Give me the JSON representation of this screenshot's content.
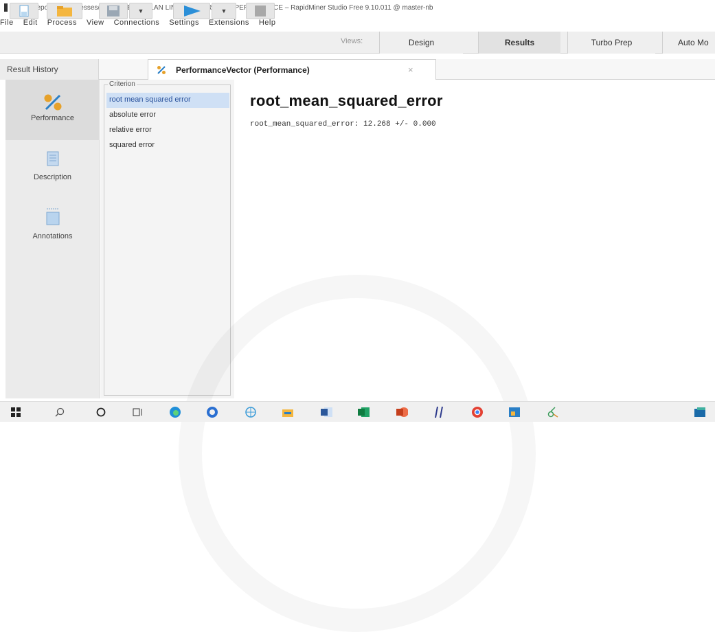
{
  "window": {
    "title": "//Local Repository/processes/TOTAL PENJUALAN LINEAR REGRATION-PERFORMACE – RapidMiner Studio Free 9.10.011 @ master-nb"
  },
  "menu": [
    "File",
    "Edit",
    "Process",
    "View",
    "Connections",
    "Settings",
    "Extensions",
    "Help"
  ],
  "toolbar": {
    "views_label": "Views:",
    "views": [
      {
        "label": "Design",
        "active": false
      },
      {
        "label": "Results",
        "active": true
      },
      {
        "label": "Turbo Prep",
        "active": false
      },
      {
        "label": "Auto Mo",
        "active": false
      }
    ]
  },
  "tabs": {
    "history": "Result History",
    "performance": "PerformanceVector (Performance)",
    "close": "×"
  },
  "sidebar": {
    "items": [
      {
        "label": "Performance",
        "icon": "percent-icon",
        "active": true
      },
      {
        "label": "Description",
        "icon": "document-icon",
        "active": false
      },
      {
        "label": "Annotations",
        "icon": "note-icon",
        "active": false
      }
    ]
  },
  "criterion": {
    "legend": "Criterion",
    "items": [
      "root mean squared error",
      "absolute error",
      "relative error",
      "squared error"
    ],
    "selected_index": 0
  },
  "main": {
    "heading": "root_mean_squared_error",
    "value_line": "root_mean_squared_error: 12.268 +/- 0.000"
  },
  "taskbar": {
    "icons": [
      "windows-start-icon",
      "search-icon",
      "cortana-icon",
      "task-view-icon",
      "edge-icon",
      "browser-icon",
      "network-icon",
      "file-explorer-icon",
      "word-icon",
      "excel-icon",
      "powerpoint-icon",
      "hash-icon",
      "chrome-icon",
      "rapidminer-icon",
      "app-icon",
      "stack-icon"
    ]
  },
  "colors": {
    "selection": "#cfe0f5",
    "play": "#2b8fd8",
    "folder": "#f4b63f"
  }
}
